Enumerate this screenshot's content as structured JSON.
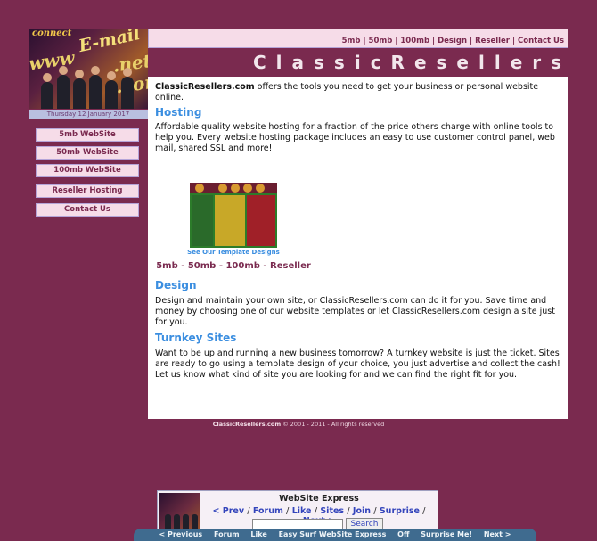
{
  "logo": {
    "text_connect": "connect",
    "text_email": "E-mail",
    "text_www": "www",
    "text_net_com": ".net .com"
  },
  "date": "Thursday 12 January 2017",
  "nav": {
    "items": [
      {
        "label": "5mb WebSite"
      },
      {
        "label": "50mb WebSite"
      },
      {
        "label": "100mb WebSite"
      },
      {
        "label": "Reseller Hosting"
      },
      {
        "label": "Contact Us"
      }
    ]
  },
  "topnav": {
    "items": [
      "5mb",
      "50mb",
      "100mb",
      "Design",
      "Reseller",
      "Contact Us"
    ],
    "separator": "|"
  },
  "banner": {
    "title": "ClassicResellers.com"
  },
  "content": {
    "intro_brand": "ClassicResellers.com",
    "intro_text": " offers the tools you need to get your business or personal website online.",
    "hosting_heading": "Hosting",
    "hosting_text": "Affordable quality website hosting for a fraction of the price others charge with online tools to help you. Every website hosting package includes an easy to use customer control panel, web mail, shared SSL and more!",
    "template_caption": "See Our Template Designs",
    "sizes_line": "5mb - 50mb - 100mb - Reseller",
    "design_heading": "Design",
    "design_text": "Design and maintain your own site, or ClassicResellers.com can do it for you. Save time and money by choosing one of our website templates or let ClassicResellers.com design a site just for you.",
    "turnkey_heading": "Turnkey Sites",
    "turnkey_text": "Want to be up and running a new business tomorrow? A turnkey website is just the ticket. Sites are ready to go using a template design of your choice, you just advertise and collect the cash! Let us know what kind of site you are looking for and we can find the right fit for you."
  },
  "footer": {
    "brand": "ClassicResellers.com",
    "text": " © 2001 - 2011 - All rights reserved"
  },
  "widget": {
    "title": "WebSite Express",
    "links": [
      "< Prev",
      "Forum",
      "Like",
      "Sites",
      "Join",
      "Surprise",
      "Next >"
    ],
    "link_separator": "/",
    "search_button": "Search"
  },
  "bottombar": {
    "items": [
      "< Previous",
      "Forum",
      "Like",
      "Easy Surf WebSite Express",
      "Off",
      "Surprise Me!",
      "Next >"
    ]
  },
  "colors": {
    "background": "#7a2a4f",
    "nav_button_bg": "#f6dce8",
    "heading_blue": "#3b8ee0",
    "maroon_text": "#7a2a4f"
  }
}
